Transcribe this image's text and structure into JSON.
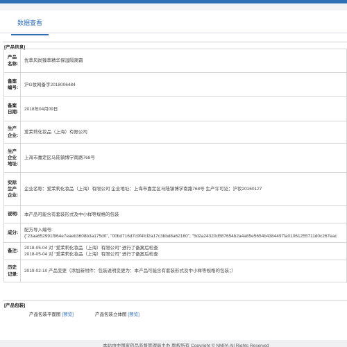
{
  "tab": {
    "label": "数据查看"
  },
  "section1": {
    "title": "[产品信息]"
  },
  "rows": [
    {
      "label": "产品名称:",
      "value": "优萃风尚臻萃精华保湿隔离霜"
    },
    {
      "label": "备案编号:",
      "value": "沪G妆网备字2018006484"
    },
    {
      "label": "备案日期:",
      "value": "2018年04月09日"
    },
    {
      "label": "生产企业:",
      "value": "爱茉莉化妆品（上海）有限公司"
    },
    {
      "label": "生产企业地址:",
      "value": "上海市嘉定区马陆镇博学南路768号"
    },
    {
      "label": "实际生产企业:",
      "value": "企业名称：爱茉莉化妆品（上海）有限公司 企业地址：上海市嘉定区马陆镇博学南路768号 生产许可证：沪妆20160127"
    },
    {
      "label": "说明:",
      "value": "本产品可能含有套装形式及中小样等规格的包装"
    },
    {
      "label": "成分:",
      "value_line1": "配方导入编号:",
      "value_line2": "{\"23aa652991f964e7eaeb3608b3a175d0\", \"00bd716d7c9f4fcf2a17c3bbd8a62160\", \"5d2a24320d587654b2a4a85e5654b4384497fa01061255711d0c267eac"
    },
    {
      "label": "备注:",
      "value_line1": "2018-05-04 对 \"爱茉莉化妆品（上海）有限公司\" 进行了备案后检查",
      "value_line2": "2018-05-04 对 \"爱茉莉化妆品（上海）有限公司\" 进行了备案后检查"
    },
    {
      "label": "历史记录:",
      "value": "2019-02-10 产品变更（添加新附件：包装说明变更为：本产品可能含有套装形式及中小样等规格的包装；）"
    }
  ],
  "section2": {
    "title": "[产品包装]"
  },
  "packaging": {
    "flat_label": "产品包装平面图",
    "flat_link": "[预览]",
    "solid_label": "产品包装立体图",
    "solid_link": "[预览]"
  },
  "footer": {
    "text": "本站由中国家药品监督管理局主办 版权所有 Copyright © NMPA All Rights Reserved"
  }
}
